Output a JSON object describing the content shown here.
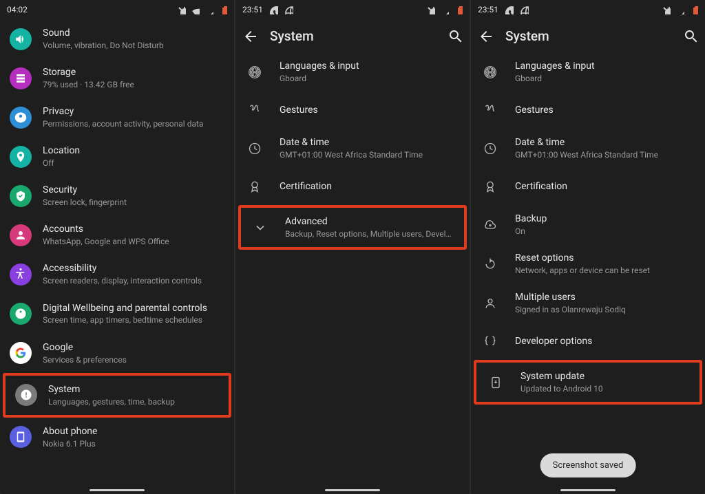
{
  "pane1": {
    "time": "04:02",
    "items": [
      {
        "name": "sound",
        "title": "Sound",
        "sub": "Volume, vibration, Do Not Disturb",
        "color": "#14b3a4"
      },
      {
        "name": "storage",
        "title": "Storage",
        "sub": "79% used · 13.42 GB free",
        "color": "#b52fbf"
      },
      {
        "name": "privacy",
        "title": "Privacy",
        "sub": "Permissions, account activity, personal data",
        "color": "#2e8fd6"
      },
      {
        "name": "location",
        "title": "Location",
        "sub": "Off",
        "color": "#14b3a4"
      },
      {
        "name": "security",
        "title": "Security",
        "sub": "Screen lock, fingerprint",
        "color": "#1aa86f"
      },
      {
        "name": "accounts",
        "title": "Accounts",
        "sub": "WhatsApp, Google and WPS Office",
        "color": "#d63a7a"
      },
      {
        "name": "accessibility",
        "title": "Accessibility",
        "sub": "Screen readers, display, interaction controls",
        "color": "#8a3fe0"
      },
      {
        "name": "wellbeing",
        "title": "Digital Wellbeing and parental controls",
        "sub": "Screen time, app timers, bedtime schedules",
        "color": "#1aa86f"
      },
      {
        "name": "google",
        "title": "Google",
        "sub": "Services & preferences",
        "color": "#ffffff"
      },
      {
        "name": "system",
        "title": "System",
        "sub": "Languages, gestures, time, backup",
        "color": "#7a7a7a",
        "highlight": true
      },
      {
        "name": "about",
        "title": "About phone",
        "sub": "Nokia 6.1 Plus",
        "color": "#5a5fe0"
      }
    ]
  },
  "pane2": {
    "time": "23:51",
    "title": "System",
    "items": [
      {
        "name": "langinput",
        "title": "Languages & input",
        "sub": "Gboard",
        "icon": "globe"
      },
      {
        "name": "gestures",
        "title": "Gestures",
        "sub": "",
        "icon": "gesture"
      },
      {
        "name": "datetime",
        "title": "Date & time",
        "sub": "GMT+01:00 West Africa Standard Time",
        "icon": "clock"
      },
      {
        "name": "certification",
        "title": "Certification",
        "sub": "",
        "icon": "badge"
      },
      {
        "name": "advanced",
        "title": "Advanced",
        "sub": "Backup, Reset options, Multiple users, Developer o…",
        "icon": "chevdown",
        "highlight": true
      }
    ]
  },
  "pane3": {
    "time": "23:51",
    "title": "System",
    "toast": "Screenshot saved",
    "items": [
      {
        "name": "langinput",
        "title": "Languages & input",
        "sub": "Gboard",
        "icon": "globe"
      },
      {
        "name": "gestures",
        "title": "Gestures",
        "sub": "",
        "icon": "gesture"
      },
      {
        "name": "datetime",
        "title": "Date & time",
        "sub": "GMT+01:00 West Africa Standard Time",
        "icon": "clock"
      },
      {
        "name": "certification",
        "title": "Certification",
        "sub": "",
        "icon": "badge"
      },
      {
        "name": "backup",
        "title": "Backup",
        "sub": "On",
        "icon": "cloud"
      },
      {
        "name": "reset",
        "title": "Reset options",
        "sub": "Network, apps or device can be reset",
        "icon": "reset"
      },
      {
        "name": "multuser",
        "title": "Multiple users",
        "sub": "Signed in as Olanrewaju Sodiq",
        "icon": "person"
      },
      {
        "name": "devopt",
        "title": "Developer options",
        "sub": "",
        "icon": "braces"
      },
      {
        "name": "sysupdate",
        "title": "System update",
        "sub": "Updated to Android 10",
        "icon": "update",
        "highlight": true
      }
    ]
  }
}
